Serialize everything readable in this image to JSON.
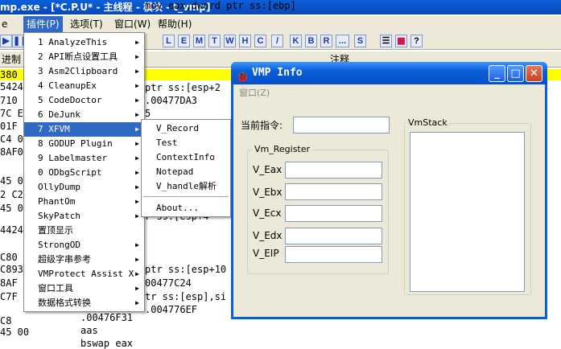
{
  "window": {
    "title": "mp.exe - [*C.P.U* - 主线程 - 模块 - t_vmp]"
  },
  "menubar": {
    "items": [
      {
        "label": "插件(P)"
      },
      {
        "label": "选项(T)"
      },
      {
        "label": "窗口(W)"
      },
      {
        "label": "帮助(H)"
      }
    ],
    "left_fragment": "e"
  },
  "toolbar": {
    "buttons": [
      "L",
      "E",
      "M",
      "T",
      "W",
      "H",
      "C",
      "/",
      "K",
      "B",
      "R",
      "...",
      "S"
    ]
  },
  "cpu": {
    "headers": [
      "进制",
      "注释"
    ],
    "left_addrs": [
      "380",
      "5424",
      "710",
      "7C E",
      "01F",
      "C4 0",
      "8AF0",
      "45 0",
      "2 C2",
      "45 0",
      "4424",
      "C80",
      "C893",
      "8AF",
      "C7F",
      "C8",
      "45 00"
    ],
    "code_lines": [
      "ptr ss:[esp+2",
      ".00477DA3",
      "5",
      "",
      "",
      "",
      "",
      "",
      "r ss:[esp+4",
      "",
      "ptr ss:[esp+10",
      "00477C24",
      "tr ss:[esp],si",
      ".004776EF",
      ".00476F31",
      "aas",
      "bswap eax",
      "mov eax,dword ptr ss:[ebp]"
    ]
  },
  "plugin_menu": {
    "items": [
      {
        "label": "1 AnalyzeThis",
        "arrow": true
      },
      {
        "label": "2 API断点设置工具",
        "arrow": true
      },
      {
        "label": "3 Asm2Clipboard",
        "arrow": true
      },
      {
        "label": "4 CleanupEx",
        "arrow": true
      },
      {
        "label": "5 CodeDoctor",
        "arrow": true
      },
      {
        "label": "6 DeJunk",
        "arrow": true
      },
      {
        "label": "7 XFVM",
        "arrow": true,
        "selected": true
      },
      {
        "label": "8 GODUP Plugin",
        "arrow": true
      },
      {
        "label": "9 Labelmaster",
        "arrow": true
      },
      {
        "label": "0 ODbgScript",
        "arrow": true
      },
      {
        "label": "OllyDump",
        "arrow": true
      },
      {
        "label": "PhantOm",
        "arrow": true
      },
      {
        "label": "SkyPatch",
        "arrow": true
      },
      {
        "label": "置顶显示",
        "arrow": false
      },
      {
        "label": "StrongOD",
        "arrow": true
      },
      {
        "label": "超级字串参考",
        "arrow": true
      },
      {
        "label": "VMProtect Assist X",
        "arrow": true
      },
      {
        "label": "窗口工具",
        "arrow": true
      },
      {
        "label": "数据格式转换",
        "arrow": true
      }
    ]
  },
  "submenu": {
    "items": [
      "V_Record",
      "Test",
      "ContextInfo",
      "Notepad",
      "V_handle解析",
      "About..."
    ]
  },
  "vmp_window": {
    "title": "VMP Info",
    "menu": "窗口(Z)",
    "current_instr_label": "当前指令:",
    "current_instr_value": "",
    "register_group": "Vm_Register",
    "registers": [
      {
        "name": "V_Eax",
        "value": ""
      },
      {
        "name": "V_Ebx",
        "value": ""
      },
      {
        "name": "V_Ecx",
        "value": ""
      },
      {
        "name": "V_Edx",
        "value": ""
      },
      {
        "name": "V_EIP",
        "value": ""
      }
    ],
    "stack_group": "VmStack",
    "buttons": {
      "minimize": "_",
      "maximize": "□",
      "close": "✕"
    }
  }
}
